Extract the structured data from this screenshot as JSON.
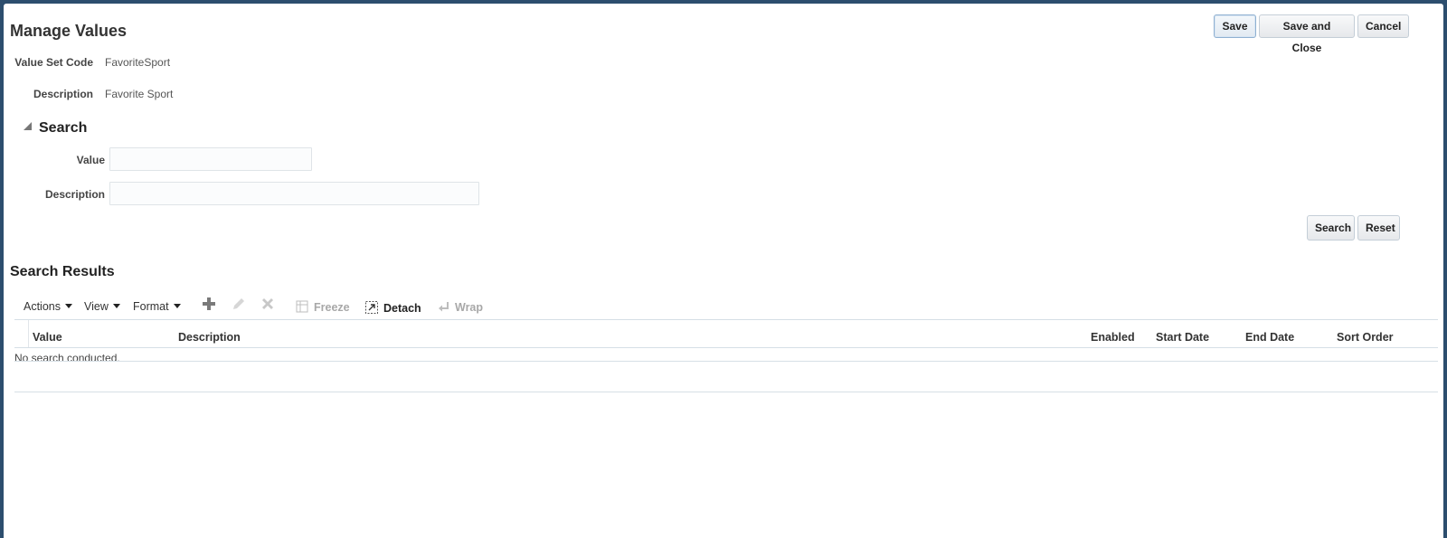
{
  "page": {
    "title": "Manage Values"
  },
  "toolbar": {
    "save": "Save",
    "save_close": "Save and Close",
    "cancel": "Cancel"
  },
  "info": {
    "value_set_code_label": "Value Set Code",
    "value_set_code": "FavoriteSport",
    "description_label": "Description",
    "description": "Favorite Sport"
  },
  "search": {
    "heading": "Search",
    "value_label": "Value",
    "value_input": "",
    "description_label": "Description",
    "description_input": "",
    "search_button": "Search",
    "reset_button": "Reset"
  },
  "results": {
    "heading": "Search Results",
    "menu": {
      "actions": "Actions",
      "view": "View",
      "format": "Format"
    },
    "tools": {
      "freeze": "Freeze",
      "detach": "Detach",
      "wrap": "Wrap"
    },
    "columns": [
      "Value",
      "Description",
      "Enabled",
      "Start Date",
      "End Date",
      "Sort Order"
    ],
    "empty_message": "No search conducted."
  },
  "icons": {
    "add": "plus-icon",
    "edit": "pencil-icon",
    "delete": "x-icon",
    "freeze": "freeze-icon",
    "detach": "detach-icon",
    "wrap": "wrap-icon"
  },
  "colors": {
    "frame": "#2d4e6e",
    "disabled": "#a8a8a8"
  }
}
